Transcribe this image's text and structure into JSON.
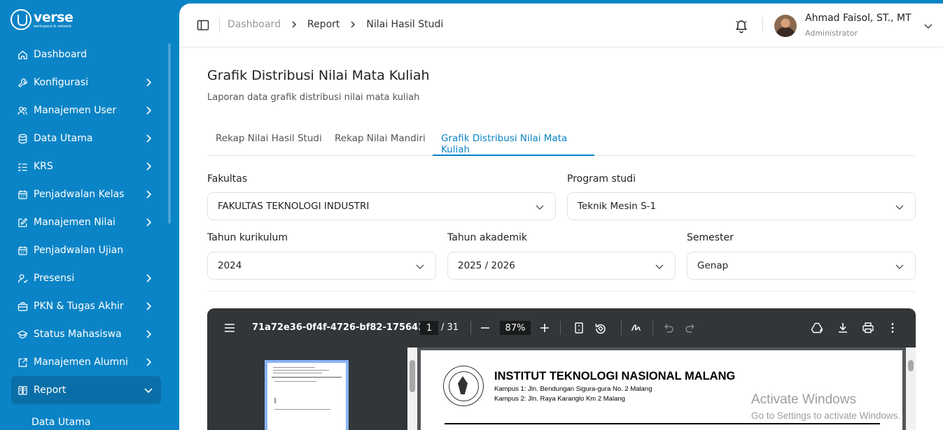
{
  "brand": {
    "name": "verse",
    "tagline": "workspace & network"
  },
  "sidebar": {
    "items": [
      {
        "label": "Dashboard",
        "icon": "home-icon",
        "has_children": false
      },
      {
        "label": "Konfigurasi",
        "icon": "wrench-icon",
        "has_children": true
      },
      {
        "label": "Manajemen User",
        "icon": "users-icon",
        "has_children": true
      },
      {
        "label": "Data Utama",
        "icon": "database-icon",
        "has_children": true
      },
      {
        "label": "KRS",
        "icon": "checklist-icon",
        "has_children": true
      },
      {
        "label": "Penjadwalan Kelas",
        "icon": "calendar-icon",
        "has_children": true
      },
      {
        "label": "Manajemen Nilai",
        "icon": "edit-icon",
        "has_children": true
      },
      {
        "label": "Penjadwalan Ujian",
        "icon": "calendar-icon",
        "has_children": false
      },
      {
        "label": "Presensi",
        "icon": "user-check-icon",
        "has_children": true
      },
      {
        "label": "PKN & Tugas Akhir",
        "icon": "briefcase-icon",
        "has_children": true
      },
      {
        "label": "Status Mahasiswa",
        "icon": "graduation-cap-icon",
        "has_children": true
      },
      {
        "label": "Manajemen Alumni",
        "icon": "alumni-icon",
        "has_children": true
      },
      {
        "label": "Report",
        "icon": "report-icon",
        "has_children": true,
        "active": true
      }
    ],
    "sub_item": "Data Utama"
  },
  "header": {
    "breadcrumb": [
      "Dashboard",
      "Report",
      "Nilai Hasil Studi"
    ],
    "user_name": "Ahmad Faisol, ST., MT",
    "user_role": "Administrator"
  },
  "page": {
    "title": "Grafik Distribusi Nilai Mata Kuliah",
    "subtitle": "Laporan data grafik distribusi nilai mata kuliah"
  },
  "tabs": [
    {
      "label": "Rekap Nilai Hasil Studi",
      "active": false
    },
    {
      "label": "Rekap Nilai Mandiri",
      "active": false
    },
    {
      "label": "Grafik Distribusi Nilai Mata Kuliah",
      "active": true
    }
  ],
  "filters": {
    "fakultas": {
      "label": "Fakultas",
      "value": "FAKULTAS TEKNOLOGI INDUSTRI"
    },
    "prodi": {
      "label": "Program studi",
      "value": "Teknik Mesin S-1"
    },
    "kurikulum": {
      "label": "Tahun kurikulum",
      "value": "2024"
    },
    "akademik": {
      "label": "Tahun akademik",
      "value": "2025 / 2026"
    },
    "semester": {
      "label": "Semester",
      "value": "Genap"
    }
  },
  "pdf": {
    "filename": "71a72e36-0f4f-4726-bf82-175641...",
    "page": "1",
    "total": "/ 31",
    "zoom": "87%",
    "doc": {
      "institution": "INSTITUT TEKNOLOGI NASIONAL MALANG",
      "address1": "Kampus 1: Jln. Bendungan Sigura-gura No. 2 Malang",
      "address2": "Kampus 2: Jln. Raya Karanglo Km 2 Malang"
    }
  },
  "watermark": {
    "line1": "Activate Windows",
    "line2": "Go to Settings to activate Windows."
  },
  "colors": {
    "primary": "#0a84c6",
    "pdf_toolbar": "#323639"
  }
}
